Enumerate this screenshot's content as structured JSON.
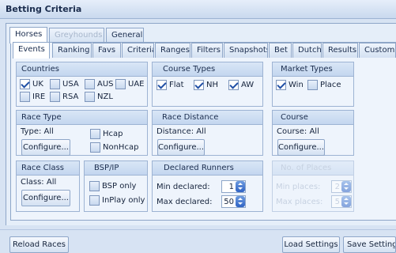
{
  "window": {
    "title": "Betting Criteria"
  },
  "sport_tabs": [
    {
      "label": "Horses",
      "state": "active"
    },
    {
      "label": "Greyhounds",
      "state": "disabled"
    },
    {
      "label": "General",
      "state": "normal"
    }
  ],
  "sub_tabs": [
    {
      "label": "Events",
      "state": "active"
    },
    {
      "label": "Ranking"
    },
    {
      "label": "Favs"
    },
    {
      "label": "Criteria"
    },
    {
      "label": "Ranges"
    },
    {
      "label": "Filters"
    },
    {
      "label": "Snapshots"
    },
    {
      "label": "Bet"
    },
    {
      "label": "Dutch"
    },
    {
      "label": "Results"
    },
    {
      "label": "Custom"
    }
  ],
  "countries": {
    "title": "Countries",
    "items": [
      {
        "label": "UK",
        "checked": true
      },
      {
        "label": "USA",
        "checked": false
      },
      {
        "label": "AUS",
        "checked": false
      },
      {
        "label": "UAE",
        "checked": false
      },
      {
        "label": "IRE",
        "checked": false
      },
      {
        "label": "RSA",
        "checked": false
      },
      {
        "label": "NZL",
        "checked": false
      }
    ]
  },
  "course_types": {
    "title": "Course Types",
    "items": [
      {
        "label": "Flat",
        "checked": true
      },
      {
        "label": "NH",
        "checked": true
      },
      {
        "label": "AW",
        "checked": true
      }
    ]
  },
  "market_types": {
    "title": "Market Types",
    "items": [
      {
        "label": "Win",
        "checked": true
      },
      {
        "label": "Place",
        "checked": false
      }
    ]
  },
  "race_type": {
    "title": "Race Type",
    "value_text": "Type: All",
    "configure": "Configure...",
    "items": [
      {
        "label": "Hcap",
        "checked": false
      },
      {
        "label": "NonHcap",
        "checked": false
      }
    ]
  },
  "race_distance": {
    "title": "Race Distance",
    "value_text": "Distance: All",
    "configure": "Configure..."
  },
  "course": {
    "title": "Course",
    "value_text": "Course: All",
    "configure": "Configure..."
  },
  "race_class": {
    "title": "Race Class",
    "value_text": "Class: All",
    "configure": "Configure..."
  },
  "bsp_ip": {
    "title": "BSP/IP",
    "items": [
      {
        "label": "BSP only",
        "checked": false
      },
      {
        "label": "InPlay only",
        "checked": false
      }
    ]
  },
  "declared_runners": {
    "title": "Declared Runners",
    "min_label": "Min declared:",
    "min_value": "1",
    "max_label": "Max declared:",
    "max_value": "50"
  },
  "places": {
    "title": "No. of Places",
    "min_label": "Min places:",
    "min_value": "2",
    "max_label": "Max places:",
    "max_value": "5"
  },
  "buttons": {
    "reload": "Reload Races",
    "load": "Load Settings",
    "save": "Save Settings"
  }
}
